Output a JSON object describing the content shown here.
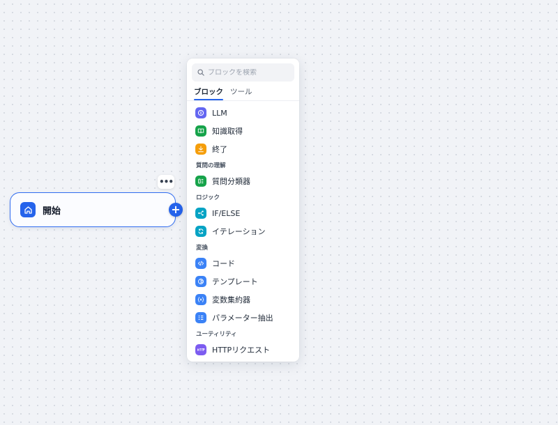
{
  "start_node": {
    "title": "開始",
    "icon": "home-icon",
    "accent": "#2563eb",
    "more_label": "•••",
    "add_label": "+"
  },
  "panel": {
    "search": {
      "placeholder": "ブロックを検索"
    },
    "tabs": [
      {
        "label": "ブロック",
        "active": true
      },
      {
        "label": "ツール",
        "active": false
      }
    ],
    "items_top": [
      {
        "label": "LLM",
        "icon": "llm-icon",
        "color": "#6366f1"
      },
      {
        "label": "知識取得",
        "icon": "knowledge-book-icon",
        "color": "#16a34a"
      },
      {
        "label": "終了",
        "icon": "end-flag-icon",
        "color": "#f59e0b"
      }
    ],
    "sections": [
      {
        "title": "質問の理解",
        "items": [
          {
            "label": "質問分類器",
            "icon": "question-classifier-icon",
            "color": "#16a34a"
          }
        ]
      },
      {
        "title": "ロジック",
        "items": [
          {
            "label": "IF/ELSE",
            "icon": "branch-icon",
            "color": "#06a3c4"
          },
          {
            "label": "イテレーション",
            "icon": "loop-icon",
            "color": "#06a3c4"
          }
        ]
      },
      {
        "title": "変換",
        "items": [
          {
            "label": "コード",
            "icon": "code-icon",
            "color": "#3b82f6"
          },
          {
            "label": "テンプレート",
            "icon": "template-icon",
            "color": "#3b82f6"
          },
          {
            "label": "変数集約器",
            "icon": "variable-icon",
            "color": "#3b82f6"
          },
          {
            "label": "パラメーター抽出",
            "icon": "parameter-extract-icon",
            "color": "#3b82f6"
          }
        ]
      },
      {
        "title": "ユーティリティ",
        "items": [
          {
            "label": "HTTPリクエスト",
            "icon": "http-icon",
            "color": "#7c5cf0"
          }
        ]
      }
    ]
  }
}
